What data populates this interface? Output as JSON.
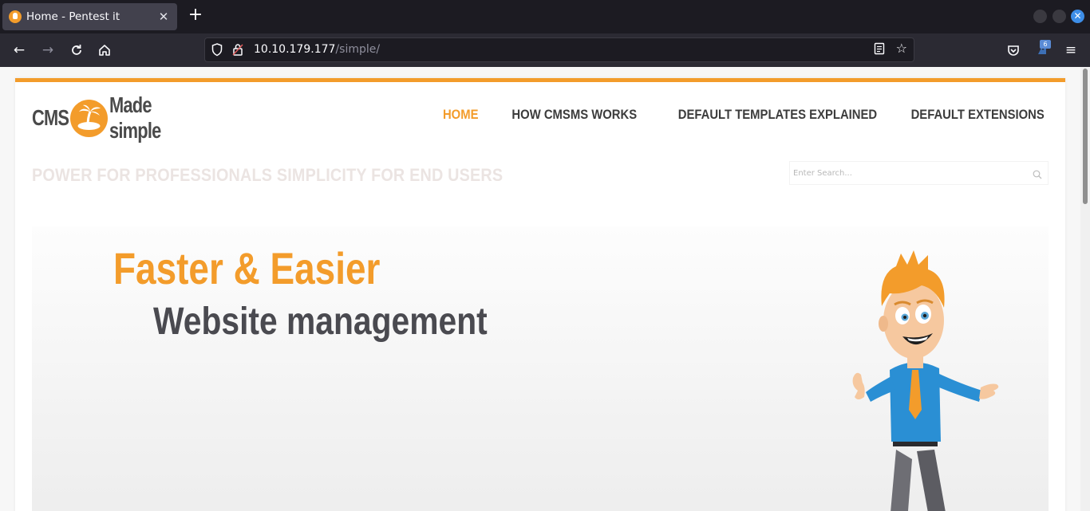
{
  "browser": {
    "tab": {
      "title": "Home - Pentest it",
      "close_glyph": "✕"
    },
    "new_tab_glyph": "+",
    "url": {
      "host": "10.10.179.177",
      "path": "/simple/"
    },
    "extension_badge": "6"
  },
  "site": {
    "logo": {
      "left_text": "CMS",
      "right_text": "Made simple"
    },
    "nav": {
      "home": "HOME",
      "how_works": "HOW CMSMS WORKS",
      "templates": "DEFAULT TEMPLATES EXPLAINED",
      "extensions": "DEFAULT EXTENSIONS"
    },
    "tagline": "POWER FOR PROFESSIONALS SIMPLICITY FOR END USERS",
    "search": {
      "placeholder": "Enter Search..."
    },
    "hero": {
      "title": "Faster & Easier",
      "subtitle": "Website management"
    }
  },
  "colors": {
    "accent": "#f39c2b",
    "text_dark": "#3c3c3c",
    "tagline": "#ebe4e2"
  },
  "icons": [
    "firefox-favicon",
    "back-icon",
    "forward-icon",
    "reload-icon",
    "home-icon",
    "shield-icon",
    "lock-icon",
    "reader-view-icon",
    "bookmark-star-icon",
    "pocket-icon",
    "extensions-icon",
    "menu-icon",
    "search-icon"
  ]
}
